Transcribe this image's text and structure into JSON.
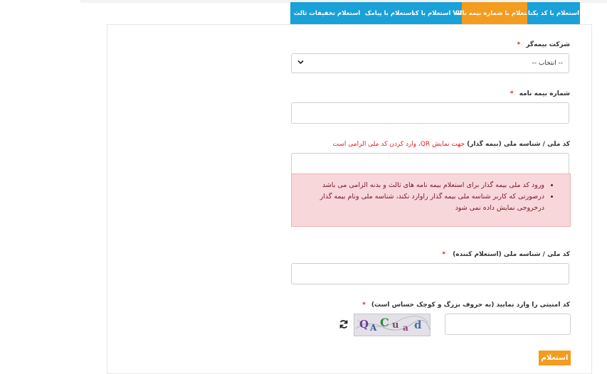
{
  "tabs": [
    {
      "label": "استعلام با کد یکتا"
    },
    {
      "label": "استعلام با شماره بیمه نامه"
    },
    {
      "label": "استعلام با کد VIN"
    },
    {
      "label": "استعلام با پیامک"
    },
    {
      "label": "استعلام تخفیفات ثالث"
    }
  ],
  "form": {
    "insurer_label": "شرکت بیمه‌گر",
    "insurer_select_value": "-- انتخاب --",
    "policy_label": "شماره بیمه نامه",
    "national_id_label": "کد ملی / شناسه ملی (بیمه گذار)",
    "national_id_note": "جهت نمایش QR، وارد کردن کد ملی الزامی است",
    "alert_items": [
      "ورود کد ملی بیمه گذار برای استعلام بیمه نامه های ثالث و بدنه الزامی می باشد",
      "درصورتی که کاربر شناسه ملی بیمه گذار راوارد نکند، شناسه ملی ونام بیمه گذار درخروجی نمایش داده نمی شود"
    ],
    "inquirer_label": "کد ملی / شناسه ملی (استعلام کننده)",
    "captcha_label": "کد امنیتی را وارد نمایید (به حروف بزرگ و کوچک حساس است)",
    "captcha_text": "QACuad",
    "required_mark": "*",
    "submit_label": "استعلام"
  }
}
